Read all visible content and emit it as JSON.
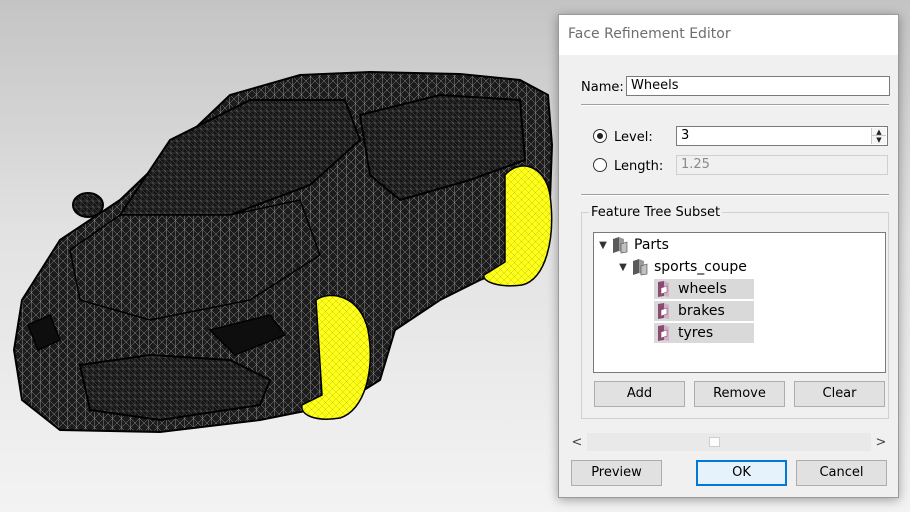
{
  "dialog": {
    "title": "Face Refinement Editor",
    "name_label": "Name:",
    "name_value": "Wheels",
    "level_label": "Level:",
    "level_value": "3",
    "level_selected": true,
    "length_label": "Length:",
    "length_value": "1.25",
    "group_title": "Feature Tree Subset",
    "tree": {
      "root": "Parts",
      "child": "sports_coupe",
      "leaves": [
        "wheels",
        "brakes",
        "tyres"
      ]
    },
    "buttons": {
      "add": "Add",
      "remove": "Remove",
      "clear": "Clear",
      "preview": "Preview",
      "ok": "OK",
      "cancel": "Cancel"
    },
    "scroll_left": "<",
    "scroll_right": ">"
  },
  "colors": {
    "mesh": "#1a1a1a",
    "highlight": "#ffff1e",
    "accent": "#0078d7",
    "part_icon": "#8a4a72"
  },
  "icons": {
    "collapse": "chevron-down-icon",
    "assembly": "assembly-icon",
    "part": "part-icon"
  }
}
